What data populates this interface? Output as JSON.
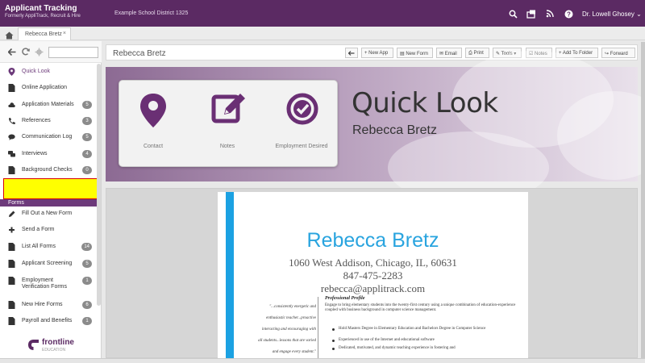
{
  "topbar": {
    "app_title": "Applicant Tracking",
    "app_sub": "Formerly AppliTrack, Recruit & Hire",
    "district": "Example School District 1325",
    "user": "Dr. Lowell Ghosey ⌄"
  },
  "tabs": [
    {
      "label": "Rebecca Bretz",
      "close": "×"
    }
  ],
  "sidebar": {
    "items": [
      {
        "label": "Quick Look",
        "badge": ""
      },
      {
        "label": "Online Application",
        "badge": ""
      },
      {
        "label": "Application Materials",
        "badge": "5"
      },
      {
        "label": "References",
        "badge": "3"
      },
      {
        "label": "Communication Log",
        "badge": "5"
      },
      {
        "label": "Interviews",
        "badge": "4"
      },
      {
        "label": "Background Checks",
        "badge": "0"
      }
    ],
    "forms_header": "Forms",
    "form_items": [
      {
        "label": "Fill Out a New Form",
        "badge": ""
      },
      {
        "label": "Send a Form",
        "badge": ""
      },
      {
        "label": "List All Forms",
        "badge": "14"
      },
      {
        "label": "Applicant Screening",
        "badge": "5"
      },
      {
        "label": "Employment Verification Forms",
        "badge": "1"
      },
      {
        "label": "New Hire Forms",
        "badge": "6"
      },
      {
        "label": "Payroll and Benefits",
        "badge": "1"
      }
    ],
    "brand": "frontline",
    "brand_sub": "EDUCATION"
  },
  "header": {
    "name": "Rebecca Bretz",
    "buttons": [
      "New App",
      "New Form",
      "Email",
      "Print",
      "Tools ▾",
      "Notes",
      "Add To Folder",
      "Forward"
    ]
  },
  "quicklook": {
    "items": [
      "Contact",
      "Notes",
      "Employment Desired"
    ],
    "title": "Quick Look",
    "name": "Rebecca Bretz"
  },
  "resume": {
    "name": "Rebecca Bretz",
    "address": "1060 West Addison, Chicago, IL, 60631",
    "phone": "847-475-2283",
    "email": "rebecca@applitrack.com",
    "quote_lines": [
      "\"...consistently energetic and",
      "enthusiastic teacher...proactive",
      "interacting and encouraging with",
      "all students...lessons that are varied",
      "and engage every student.\""
    ],
    "profile_heading": "Professional Profile",
    "profile_text": "Engage to bring elementary students into the twenty-first century using a unique combination of education-experience coupled with business background in computer science management.",
    "bullets": [
      "Hold Masters Degree in Elementary Education and Bachelors Degree in Computer Science",
      "Experienced in use of the Internet and educational software",
      "Dedicated, motivated, and dynamic teaching experience in fostering and"
    ]
  },
  "colors": {
    "brand_purple": "#5b2a63",
    "accent_blue": "#29a4df",
    "redaction_yellow": "#ffff00"
  }
}
